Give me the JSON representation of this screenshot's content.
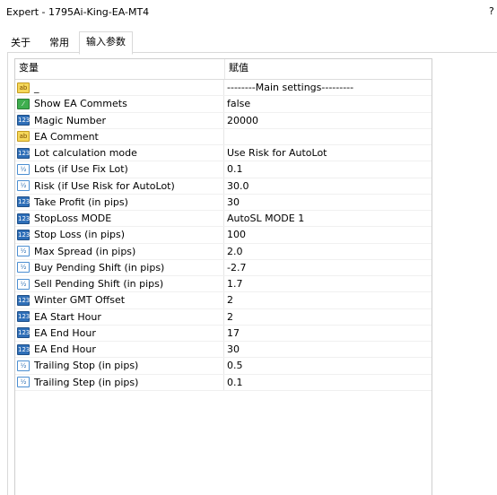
{
  "window": {
    "title": "Expert - 1795Ai-King-EA-MT4",
    "help": "?"
  },
  "tabs": [
    {
      "label": "关于"
    },
    {
      "label": "常用"
    },
    {
      "label": "输入参数"
    }
  ],
  "grid": {
    "columns": {
      "variable": "变量",
      "value": "赋值"
    },
    "rows": [
      {
        "icon": "ab-string-icon",
        "name": "_",
        "value": "--------Main settings---------"
      },
      {
        "icon": "bool-icon",
        "name": "Show EA Commets",
        "value": "false"
      },
      {
        "icon": "int-icon",
        "name": "Magic Number",
        "value": "20000"
      },
      {
        "icon": "ab-string-icon",
        "name": "EA Comment",
        "value": ""
      },
      {
        "icon": "int-icon",
        "name": "Lot calculation mode",
        "value": "Use Risk for AutoLot"
      },
      {
        "icon": "double-icon",
        "name": "Lots (if Use Fix Lot)",
        "value": "0.1"
      },
      {
        "icon": "double-icon",
        "name": "Risk (if Use Risk for AutoLot)",
        "value": "30.0"
      },
      {
        "icon": "int-icon",
        "name": "Take Profit (in pips)",
        "value": "30"
      },
      {
        "icon": "int-icon",
        "name": "StopLoss MODE",
        "value": "AutoSL MODE 1"
      },
      {
        "icon": "int-icon",
        "name": "Stop Loss (in pips)",
        "value": "100"
      },
      {
        "icon": "double-icon",
        "name": "Max Spread (in pips)",
        "value": "2.0"
      },
      {
        "icon": "double-icon",
        "name": "Buy Pending Shift (in pips)",
        "value": "-2.7"
      },
      {
        "icon": "double-icon",
        "name": "Sell Pending Shift (in pips)",
        "value": "1.7"
      },
      {
        "icon": "int-icon",
        "name": "Winter GMT Offset",
        "value": "2"
      },
      {
        "icon": "int-icon",
        "name": "EA Start Hour",
        "value": "2"
      },
      {
        "icon": "int-icon",
        "name": "EA End Hour",
        "value": "17"
      },
      {
        "icon": "int-icon",
        "name": "EA End Hour",
        "value": "30"
      },
      {
        "icon": "double-icon",
        "name": "Trailing Stop (in pips)",
        "value": "0.5"
      },
      {
        "icon": "double-icon",
        "name": "Trailing Step (in pips)",
        "value": "0.1"
      }
    ]
  }
}
